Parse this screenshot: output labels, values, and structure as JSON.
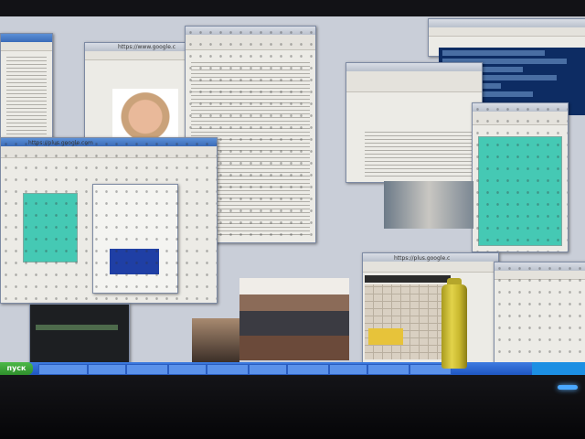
{
  "scene": "photo of a monitor displaying many overlapping application windows",
  "colors": {
    "desktop": "#c9ced8",
    "taskbar": "#2a63cf",
    "teal_document": "#45c9b4",
    "terminal": "#0d2c63",
    "power_led": "#4aa8ff"
  },
  "browser": {
    "url_left": "https://plus.google.com",
    "url_top": "https://www.google.c",
    "url_bottom": "https://plus.google.c"
  },
  "taskbar": {
    "start_label": "пуск"
  }
}
